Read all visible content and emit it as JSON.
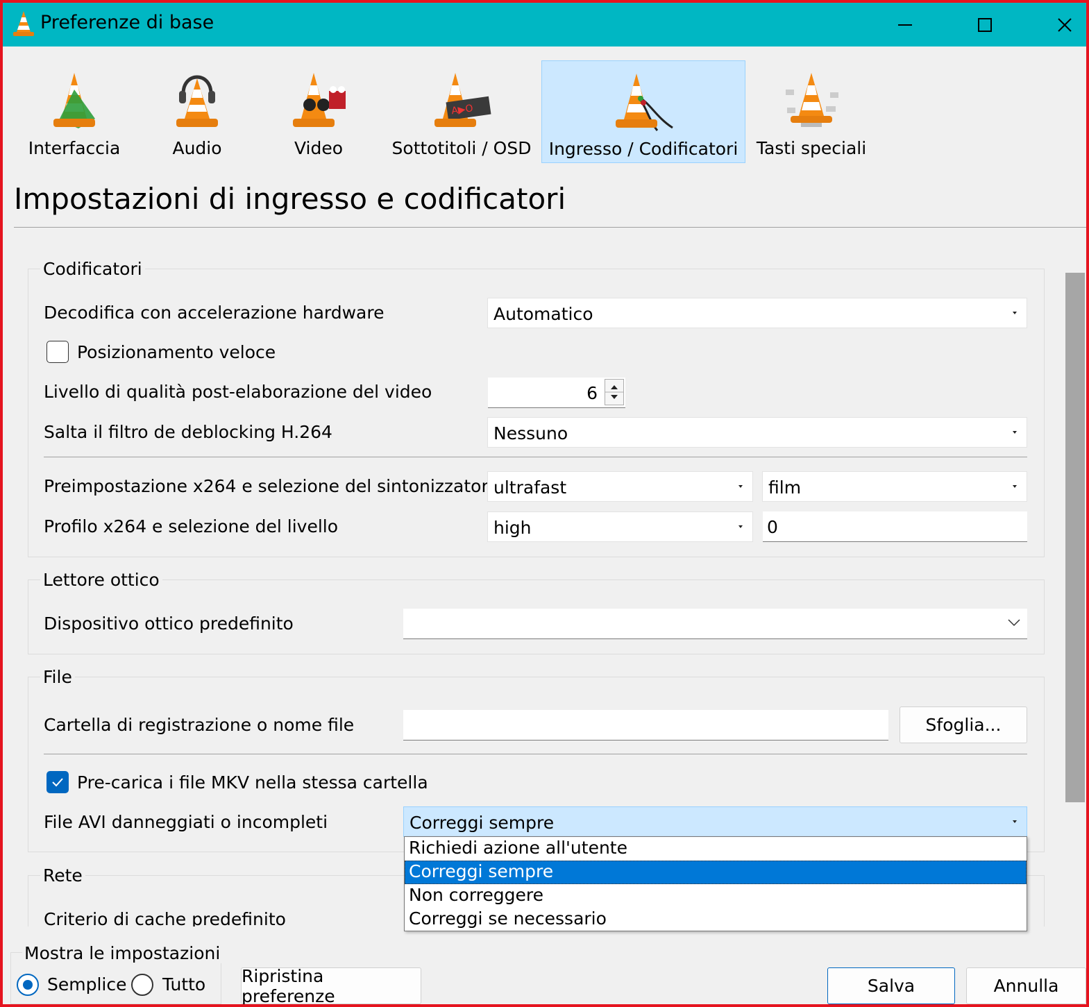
{
  "window": {
    "title": "Preferenze di base"
  },
  "tabs": [
    {
      "label": "Interfaccia"
    },
    {
      "label": "Audio"
    },
    {
      "label": "Video"
    },
    {
      "label": "Sottotitoli / OSD"
    },
    {
      "label": "Ingresso / Codificatori"
    },
    {
      "label": "Tasti speciali"
    }
  ],
  "active_tab": "Ingresso / Codificatori",
  "page": {
    "title": "Impostazioni di ingresso e codificatori"
  },
  "codecs": {
    "title": "Codificatori",
    "hw_label": "Decodifica con accelerazione hardware",
    "hw_value": "Automatico",
    "fast_seek_label": "Posizionamento veloce",
    "fast_seek_checked": false,
    "pp_label": "Livello di qualità post-elaborazione del video",
    "pp_value": "6",
    "deblock_label": "Salta il filtro de deblocking H.264",
    "deblock_value": "Nessuno",
    "x264_preset_label": "Preimpostazione x264 e selezione del sintonizzatore",
    "x264_preset_value": "ultrafast",
    "x264_tune_value": "film",
    "x264_profile_label": "Profilo x264 e selezione del livello",
    "x264_profile_value": "high",
    "x264_level_value": "0"
  },
  "optical": {
    "title": "Lettore ottico",
    "device_label": "Dispositivo ottico predefinito",
    "device_value": ""
  },
  "file": {
    "title": "File",
    "record_label": "Cartella di registrazione o nome file",
    "record_value": "",
    "browse_label": "Sfoglia...",
    "mkv_label": "Pre-carica i file MKV nella stessa cartella",
    "mkv_checked": true,
    "avi_label": "File AVI danneggiati o incompleti",
    "avi_value": "Correggi sempre",
    "avi_options": [
      "Richiedi azione all'utente",
      "Correggi sempre",
      "Non correggere",
      "Correggi se necessario"
    ],
    "avi_selected_index": 1
  },
  "network": {
    "title": "Rete",
    "cache_label": "Criterio di cache predefinito"
  },
  "bottom": {
    "show_title": "Mostra le impostazioni",
    "simple_label": "Semplice",
    "all_label": "Tutto",
    "selected": "Semplice",
    "reset_label": "Ripristina preferenze",
    "save_label": "Salva",
    "cancel_label": "Annulla"
  },
  "colors": {
    "titlebar": "#00b7c3",
    "accent": "#0078d7",
    "active_tab": "#cce8ff",
    "window_border": "#e5141f"
  }
}
